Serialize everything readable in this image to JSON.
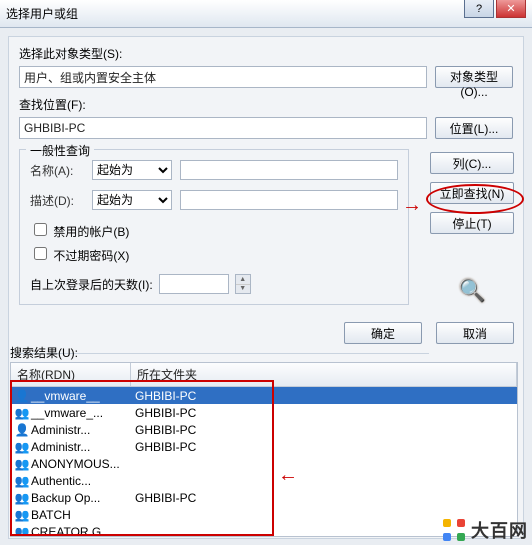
{
  "title": "选择用户或组",
  "section_objtype": {
    "label": "选择此对象类型(S):",
    "value": "用户、组或内置安全主体",
    "button": "对象类型(O)..."
  },
  "section_location": {
    "label": "查找位置(F):",
    "value": "GHBIBI-PC",
    "button": "位置(L)..."
  },
  "general_query": {
    "legend": "一般性查询",
    "name_label": "名称(A):",
    "desc_label": "描述(D):",
    "starts_with": "起始为",
    "chk_disabled": "禁用的帐户(B)",
    "chk_noexpire": "不过期密码(X)",
    "since_label": "自上次登录后的天数(I):"
  },
  "side": {
    "columns": "列(C)...",
    "search_now": "立即查找(N)",
    "stop": "停止(T)"
  },
  "ok": "确定",
  "cancel": "取消",
  "results_label": "搜索结果(U):",
  "columns": {
    "rdn": "名称(RDN)",
    "folder": "所在文件夹"
  },
  "rows": [
    {
      "icon": "user",
      "name": "__vmware__",
      "folder": "GHBIBI-PC",
      "selected": true
    },
    {
      "icon": "group",
      "name": "__vmware_...",
      "folder": "GHBIBI-PC"
    },
    {
      "icon": "user",
      "name": "Administr...",
      "folder": "GHBIBI-PC"
    },
    {
      "icon": "group",
      "name": "Administr...",
      "folder": "GHBIBI-PC"
    },
    {
      "icon": "group",
      "name": "ANONYMOUS..."
    },
    {
      "icon": "group",
      "name": "Authentic..."
    },
    {
      "icon": "group",
      "name": "Backup Op...",
      "folder": "GHBIBI-PC"
    },
    {
      "icon": "group",
      "name": "BATCH"
    },
    {
      "icon": "group",
      "name": "CREATOR G..."
    }
  ],
  "watermark": "大百网"
}
